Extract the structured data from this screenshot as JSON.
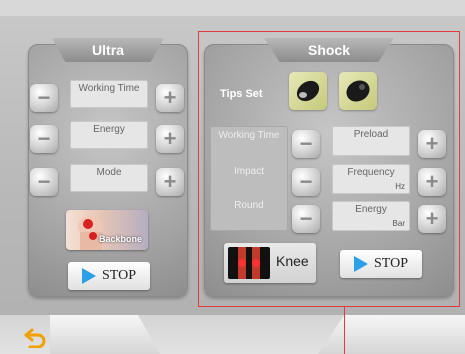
{
  "colors": {
    "accent_play": "#2aa0e6",
    "highlight_box": "#e23b3b",
    "tips_bg": "#d8dc95"
  },
  "ultra": {
    "title": "Ultra",
    "rows": [
      {
        "label": "Working Time",
        "minus_icon": "minus-icon",
        "plus_icon": "plus-icon"
      },
      {
        "label": "Energy",
        "minus_icon": "minus-icon",
        "plus_icon": "plus-icon"
      },
      {
        "label": "Mode",
        "minus_icon": "minus-icon",
        "plus_icon": "plus-icon"
      }
    ],
    "body_area": {
      "label": "Backbone"
    },
    "stop_label": "STOP"
  },
  "shock": {
    "title": "Shock",
    "tips_label": "Tips Set",
    "params_labels": [
      "Working Time",
      "Impact",
      "Round"
    ],
    "fields": [
      {
        "label": "Preload",
        "unit": ""
      },
      {
        "label": "Frequency",
        "unit": "Hz"
      },
      {
        "label": "Energy",
        "unit": "Bar"
      }
    ],
    "body_area": {
      "label": "Knee"
    },
    "stop_label": "STOP"
  },
  "nav": {
    "back_icon": "back-arrow-icon"
  }
}
